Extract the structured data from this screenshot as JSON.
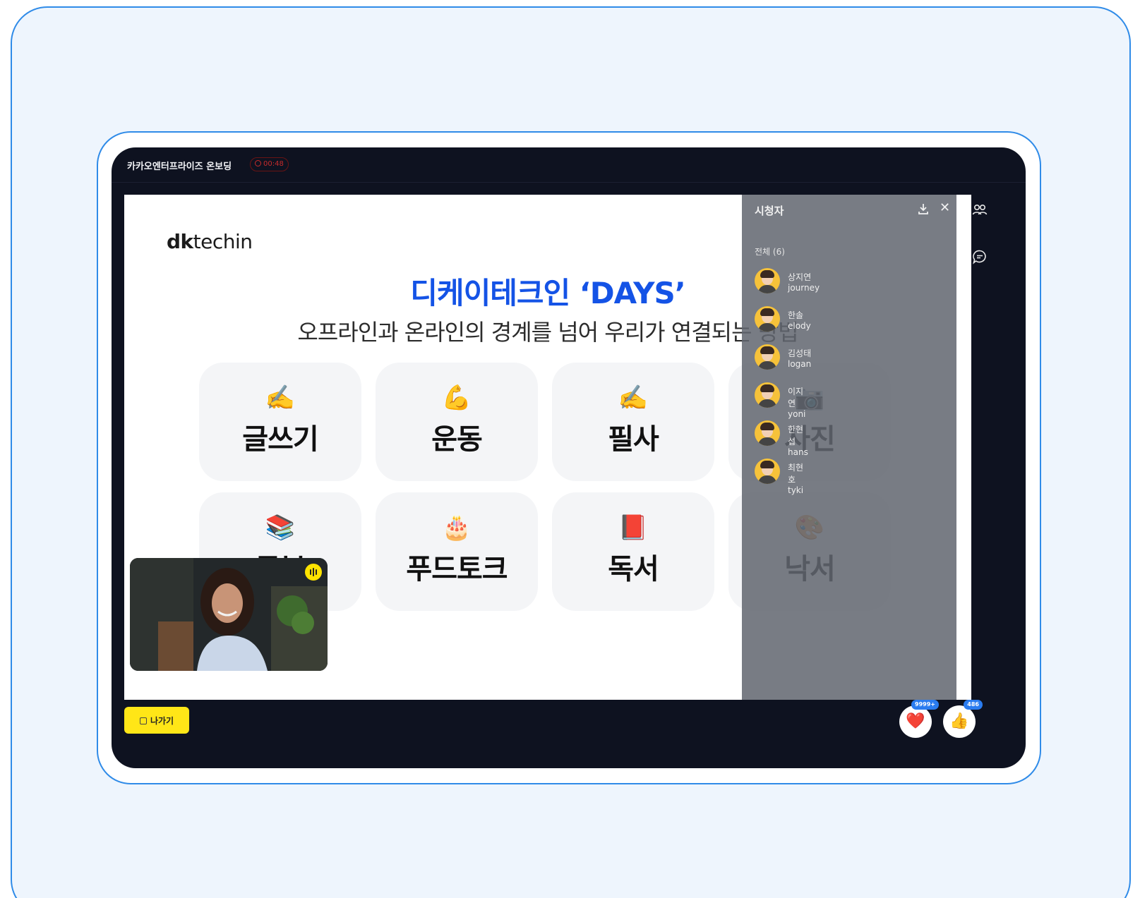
{
  "header": {
    "session_title": "카카오엔터프라이즈 온보딩",
    "timer": "00:48"
  },
  "slide": {
    "logo_bold": "dk",
    "logo_rest": "techin",
    "title": "디케이테크인 ‘DAYS’",
    "subtitle": "오프라인과 온라인의 경계를 넘어 우리가 연결되는 방법",
    "tiles": [
      {
        "emoji": "✍️",
        "label": "글쓰기"
      },
      {
        "emoji": "💪",
        "label": "운동"
      },
      {
        "emoji": "✍️",
        "label": "필사"
      },
      {
        "emoji": "📷",
        "label": "사진"
      },
      {
        "emoji": "📚",
        "label": "공부"
      },
      {
        "emoji": "🎂",
        "label": "푸드토크"
      },
      {
        "emoji": "📕",
        "label": "독서"
      },
      {
        "emoji": "🎨",
        "label": "낙서"
      }
    ]
  },
  "viewer_panel": {
    "title": "시청자",
    "count_label": "전체 (6)",
    "viewers": [
      {
        "name": "상지연 journey"
      },
      {
        "name": "한솔 elody"
      },
      {
        "name": "김성태 logan"
      },
      {
        "name": "이지연 yoni"
      },
      {
        "name": "한현섭 hans"
      },
      {
        "name": "최현호 tyki"
      }
    ]
  },
  "footer": {
    "leave_label": "나가기",
    "reactions": [
      {
        "icon": "heart-icon",
        "glyph": "❤️",
        "count": "9999+"
      },
      {
        "icon": "thumbs-up-icon",
        "glyph": "👍",
        "count": "486"
      }
    ]
  },
  "colors": {
    "accent_blue": "#1453e6",
    "leave_yellow": "#ffe617",
    "badge_blue": "#2a7cf0",
    "app_background": "#0e1220"
  }
}
